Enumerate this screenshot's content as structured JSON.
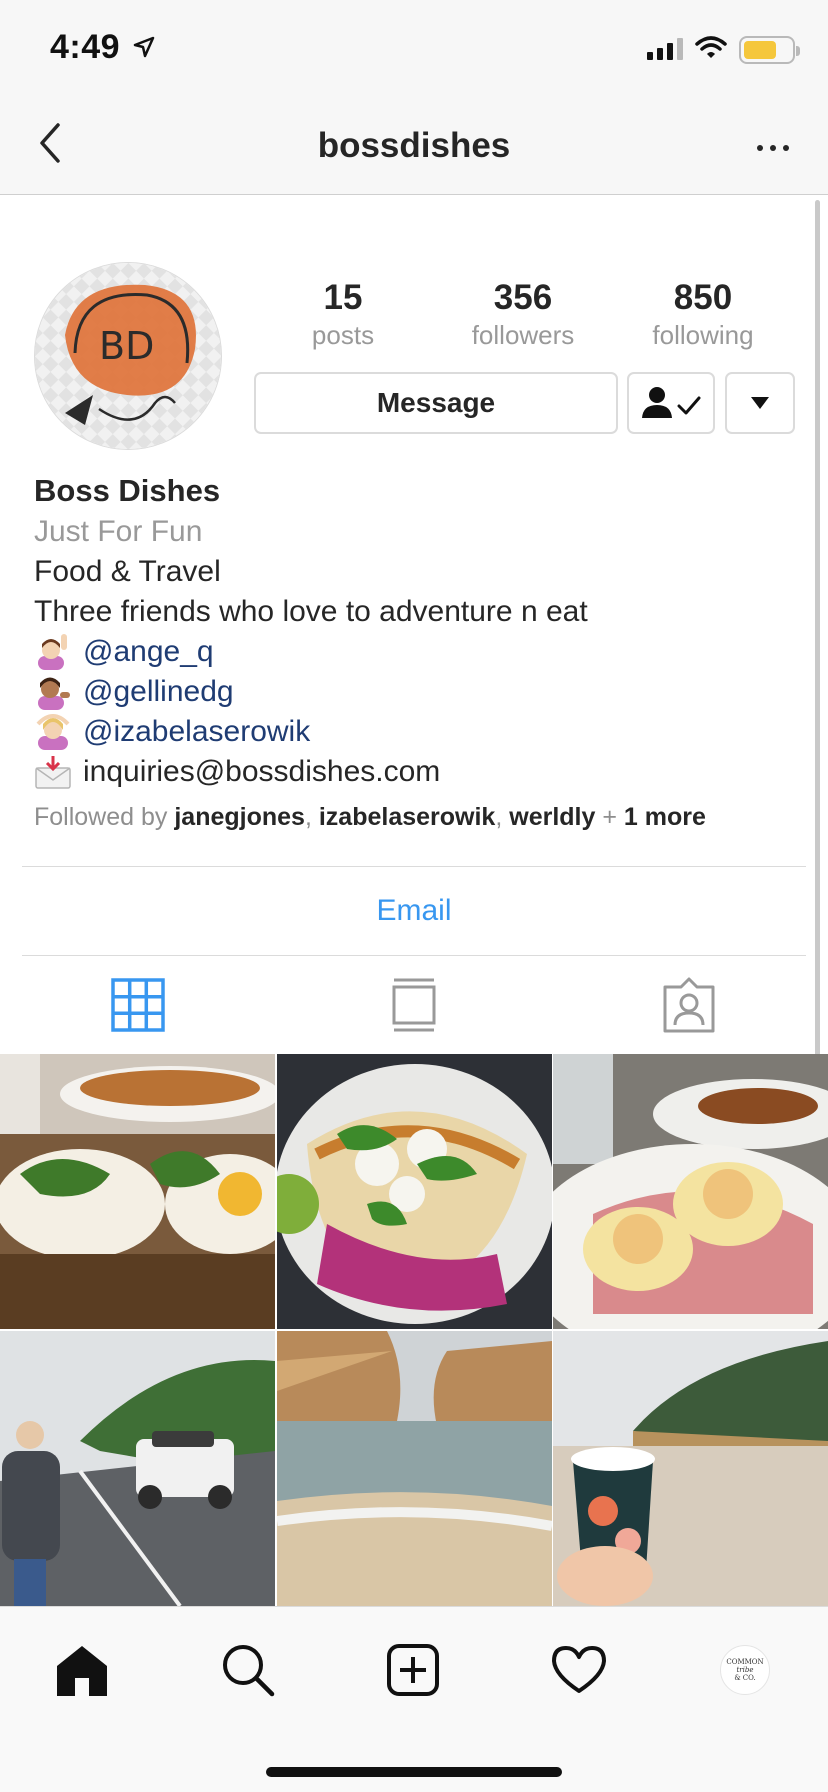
{
  "status_bar": {
    "time": "4:49"
  },
  "nav": {
    "title": "bossdishes"
  },
  "profile": {
    "avatar_initials": "BD",
    "stats": [
      {
        "value": "15",
        "label": "posts"
      },
      {
        "value": "356",
        "label": "followers"
      },
      {
        "value": "850",
        "label": "following"
      }
    ],
    "message_label": "Message"
  },
  "bio": {
    "name": "Boss Dishes",
    "category": "Just For Fun",
    "line1": "Food & Travel",
    "line2": "Three friends who love to adventure n eat",
    "mentions": [
      "@ange_q",
      "@gellinedg",
      "@izabelaserowik"
    ],
    "email_text": "inquiries@bossdishes.com",
    "followed_by": {
      "prefix": "Followed by",
      "users": [
        "janegjones",
        "izabelaserowik",
        "werldly"
      ],
      "more": "1 more"
    }
  },
  "contact": {
    "email_label": "Email"
  },
  "tabs": [
    "grid-icon",
    "feed-icon",
    "tagged-icon"
  ],
  "grid": [
    {
      "name": "grid-post-1",
      "desc": "eggs-rosti"
    },
    {
      "name": "grid-post-2",
      "desc": "fish-tacos"
    },
    {
      "name": "grid-post-3",
      "desc": "eggs-benedict"
    },
    {
      "name": "grid-post-4",
      "desc": "road-trip"
    },
    {
      "name": "grid-post-5",
      "desc": "coastal-cliffs"
    },
    {
      "name": "grid-post-6",
      "desc": "coffee-beach"
    }
  ],
  "tab_bar": {
    "items": [
      "home-icon",
      "search-icon",
      "add-post-icon",
      "activity-heart-icon",
      "profile-avatar"
    ],
    "avatar_text": [
      "COMMON",
      "tribe",
      "& CO."
    ]
  },
  "colors": {
    "link_blue": "#3897f0",
    "mention_navy": "#1f3c73",
    "battery": "#f5c73c",
    "avatar_orange": "#e0733a"
  }
}
